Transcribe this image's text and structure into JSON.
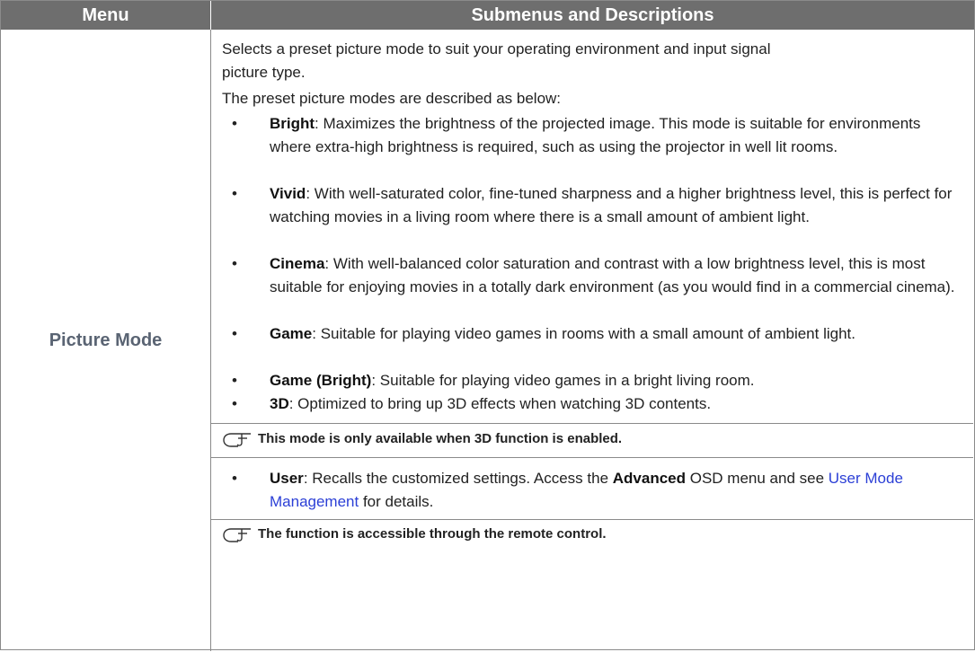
{
  "header": {
    "menu": "Menu",
    "submenus": "Submenus and Descriptions"
  },
  "menu_item": "Picture Mode",
  "intro": {
    "line1": "Selects a preset picture mode to suit your operating environment and input signal",
    "line2": "picture type.",
    "line3": "The preset picture modes are described as below:"
  },
  "modes": [
    {
      "name": "Bright",
      "desc": ": Maximizes the brightness of the projected image. This mode is suitable for environments where extra-high brightness is required, such as using the projector in well lit rooms."
    },
    {
      "name": "Vivid",
      "desc": ": With well-saturated color, fine-tuned sharpness and a higher brightness level, this is perfect for watching movies in a living room where there is a small amount of ambient light."
    },
    {
      "name": "Cinema",
      "desc": ": With well-balanced color saturation and contrast with a low brightness level, this is most suitable for enjoying movies in a totally dark environment (as you would find in a commercial cinema)."
    },
    {
      "name": "Game",
      "desc": ": Suitable for playing video games in rooms with a small amount of ambient light."
    },
    {
      "name": "Game (Bright)",
      "desc": ": Suitable for playing video games in a bright living room."
    },
    {
      "name": "3D",
      "desc": ": Optimized to bring up 3D effects when watching 3D contents."
    }
  ],
  "note_3d": "This mode is only available when 3D function is enabled.",
  "user_mode": {
    "name": "User",
    "desc_pre": ": Recalls the customized settings. Access the ",
    "advanced": "Advanced",
    "desc_mid": " OSD menu and see ",
    "link": "User Mode Management",
    "desc_post": " for details."
  },
  "note_remote": "The function is accessible through the remote control.",
  "bullet_char": "•",
  "icon_name": "note-hand-icon"
}
